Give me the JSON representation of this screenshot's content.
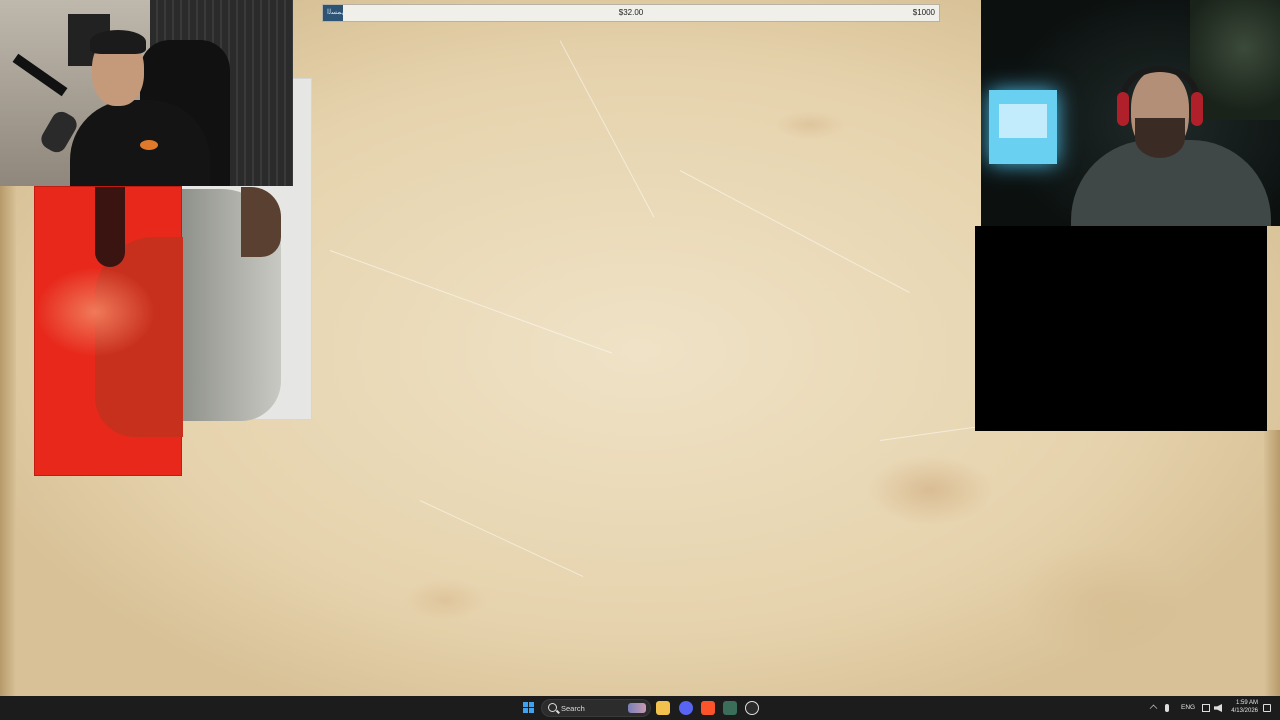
{
  "progress": {
    "fill_label": "ﻰﻤﺴﻟﺍ",
    "current": "$32.00",
    "goal": "$1000",
    "fraction": 0.032,
    "fill_color": "#2d5375"
  },
  "taskbar": {
    "search_label": "Search",
    "language": "ENG",
    "time": "1:59 AM",
    "date": "4/13/2026",
    "apps": [
      "windows-start-icon",
      "file-explorer-icon",
      "discord-icon",
      "brave-browser-icon",
      "task-manager-icon",
      "obs-icon"
    ]
  },
  "colors": {
    "parchment": "#e9d9b8",
    "taskbar": "#1c1c1c",
    "accent_red": "#e7281b",
    "monitor_glow": "#6ad0f2"
  }
}
